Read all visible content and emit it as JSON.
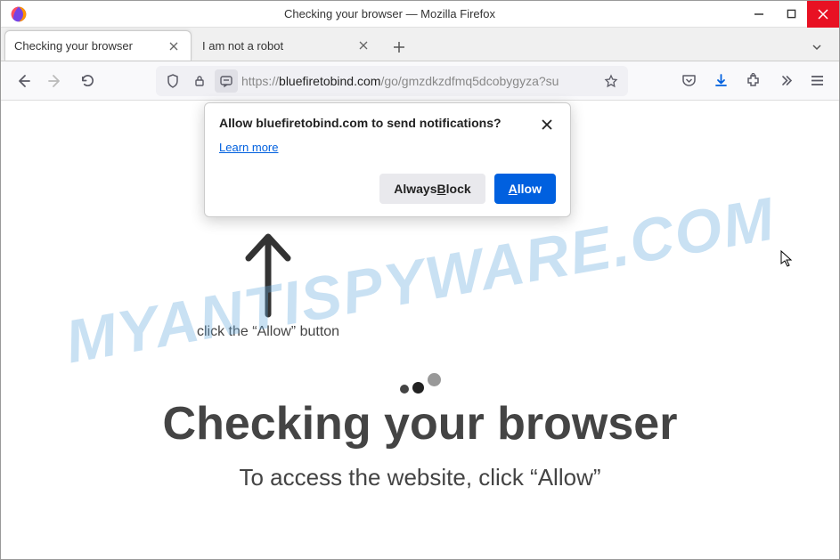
{
  "window": {
    "title": "Checking your browser — Mozilla Firefox"
  },
  "tabs": [
    {
      "label": "Checking your browser",
      "active": true
    },
    {
      "label": "I am not a robot",
      "active": false
    }
  ],
  "url": {
    "protocol": "https://",
    "domain": "bluefiretobind.com",
    "path": "/go/gmzdkzdfmq5dcobygyza?su"
  },
  "notification": {
    "title": "Allow bluefiretobind.com to send notifications?",
    "learn_more": "Learn more",
    "block_prefix": "Always ",
    "block_ul": "B",
    "block_suffix": "lock",
    "allow_ul": "A",
    "allow_suffix": "llow"
  },
  "page": {
    "hint": "click the “Allow” button",
    "heading": "Checking your browser",
    "subtext": "To access the website, click “Allow”"
  },
  "watermark": "MYANTISPYWARE.COM"
}
